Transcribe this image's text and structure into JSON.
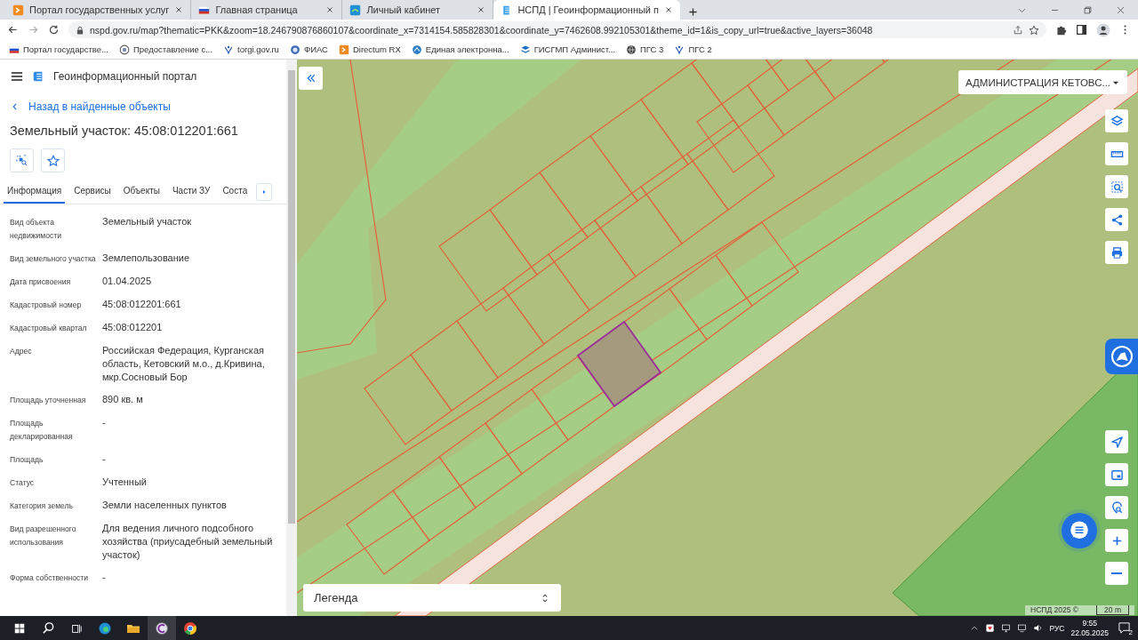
{
  "browser": {
    "tabs": [
      {
        "title": "Портал государственных услуг",
        "selected": false
      },
      {
        "title": "Главная страница",
        "selected": false
      },
      {
        "title": "Личный кабинет",
        "selected": false
      },
      {
        "title": "НСПД | Геоинформационный п",
        "selected": true
      }
    ],
    "url": "nspd.gov.ru/map?thematic=PKK&zoom=18.246790876860107&coordinate_x=7314154.585828301&coordinate_y=7462608.992105301&theme_id=1&is_copy_url=true&active_layers=36048",
    "bookmarks": [
      "Портал государстве...",
      "Предоставление с...",
      "torgi.gov.ru",
      "ФИАС",
      "Directum RX",
      "Единая электронна...",
      "ГИСГМП Админист...",
      "ПГС 3",
      "ПГС 2"
    ]
  },
  "portal": {
    "title": "Геоинформационный портал",
    "back_link": "Назад в найденные объекты",
    "heading": "Земельный участок: 45:08:012201:661",
    "tabs": [
      {
        "label": "Информация",
        "selected": true
      },
      {
        "label": "Сервисы",
        "selected": false
      },
      {
        "label": "Объекты",
        "selected": false
      },
      {
        "label": "Части ЗУ",
        "selected": false
      },
      {
        "label": "Соста",
        "selected": false
      }
    ],
    "fields": [
      {
        "label": "Вид объекта недвижимости",
        "value": "Земельный участок"
      },
      {
        "label": "Вид земельного участка",
        "value": "Землепользование"
      },
      {
        "label": "Дата присвоения",
        "value": "01.04.2025"
      },
      {
        "label": "Кадастровый номер",
        "value": "45:08:012201:661"
      },
      {
        "label": "Кадастровый квартал",
        "value": "45:08:012201"
      },
      {
        "label": "Адрес",
        "value": "Российская Федерация, Курганская область, Кетовский м.о., д.Кривина, мкр.Сосновый Бор"
      },
      {
        "label": "Площадь уточненная",
        "value": "890 кв. м"
      },
      {
        "label": "Площадь декларированная",
        "value": "-"
      },
      {
        "label": "Площадь",
        "value": "-"
      },
      {
        "label": "Статус",
        "value": "Учтенный"
      },
      {
        "label": "Категория земель",
        "value": "Земли населенных пунктов"
      },
      {
        "label": "Вид разрешенного использования",
        "value": "Для ведения личного подсобного хозяйства (приусадебный земельный участок)"
      },
      {
        "label": "Форма собственности",
        "value": "-"
      }
    ]
  },
  "map": {
    "region": "АДМИНИСТРАЦИЯ КЕТОВС...",
    "legend": "Легенда",
    "attribution": "НСПД 2025 ©",
    "scale": "20 m"
  },
  "taskbar": {
    "language": "РУС",
    "time": "9:55",
    "date": "22.05.2025",
    "notifications": "2"
  }
}
